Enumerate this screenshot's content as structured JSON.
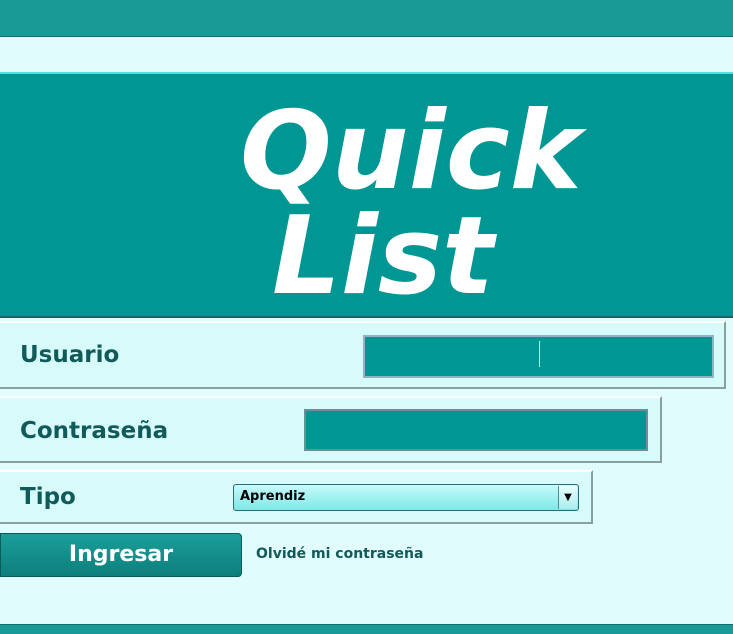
{
  "logo": {
    "line1": "Quick",
    "line2": "List"
  },
  "form": {
    "user_label": "Usuario",
    "user_value": "",
    "password_label": "Contraseña",
    "password_value": "",
    "type_label": "Tipo",
    "type_selected": "Aprendiz",
    "submit_label": "Ingresar",
    "forgot_label": "Olvidé mi contraseña"
  },
  "colors": {
    "accent": "#009694",
    "background": "#e0fcfc",
    "label_text": "#115a5a"
  }
}
